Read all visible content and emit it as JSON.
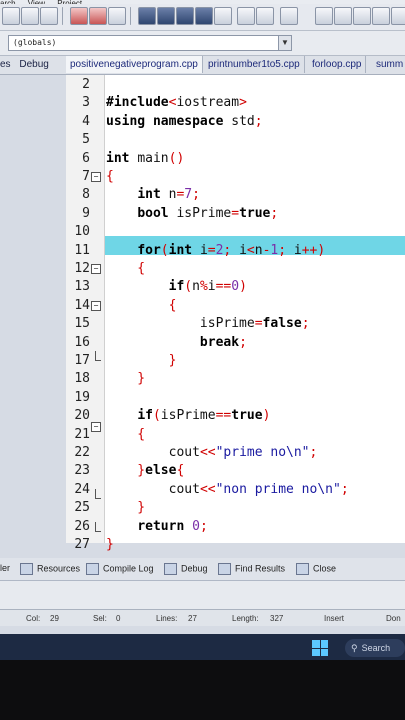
{
  "menu": [
    "arch",
    "View",
    "Project"
  ],
  "toolbar": {
    "scope_value": "(globals)"
  },
  "left_tabs": [
    "es",
    "Debug"
  ],
  "file_tabs": [
    "positivenegativeprogram.cpp",
    "printnumber1to5.cpp",
    "forloop.cpp",
    "summ"
  ],
  "editor": {
    "line_numbers": [
      "2",
      "3",
      "4",
      "5",
      "6",
      "7",
      "8",
      "9",
      "10",
      "11",
      "12",
      "13",
      "14",
      "15",
      "16",
      "17",
      "18",
      "19",
      "20",
      "21",
      "22",
      "23",
      "24",
      "25",
      "26",
      "27"
    ],
    "highlighted_line": "11",
    "lines": [
      "",
      "#include<iostream>",
      "using namespace std;",
      "",
      "int main()",
      "{",
      "    int n=7;",
      "    bool isPrime=true;",
      "",
      "    for(int i=2; i<n-1; i++)",
      "    {",
      "        if(n%i==0)",
      "        {",
      "            isPrime=false;",
      "            break;",
      "        }",
      "    }",
      "",
      "    if(isPrime==true)",
      "    {",
      "        cout<<\"prime no\\n\";",
      "    }else{",
      "        cout<<\"non prime no\\n\";",
      "    }",
      "    return 0;",
      "}"
    ]
  },
  "bottom_tabs": [
    "ler",
    "Resources",
    "Compile Log",
    "Debug",
    "Find Results",
    "Close"
  ],
  "status": {
    "col_label": "Col:",
    "col_value": "29",
    "sel_label": "Sel:",
    "sel_value": "0",
    "lines_label": "Lines:",
    "lines_value": "27",
    "length_label": "Length:",
    "length_value": "327",
    "mode": "Insert",
    "extra": "Don"
  },
  "taskbar": {
    "search_label": "Search"
  },
  "colors": {
    "current_line": "#6fd6e6",
    "keyword": "#000000",
    "number": "#7a2ea8",
    "string": "#1a1aa0",
    "operator": "#c00000"
  }
}
